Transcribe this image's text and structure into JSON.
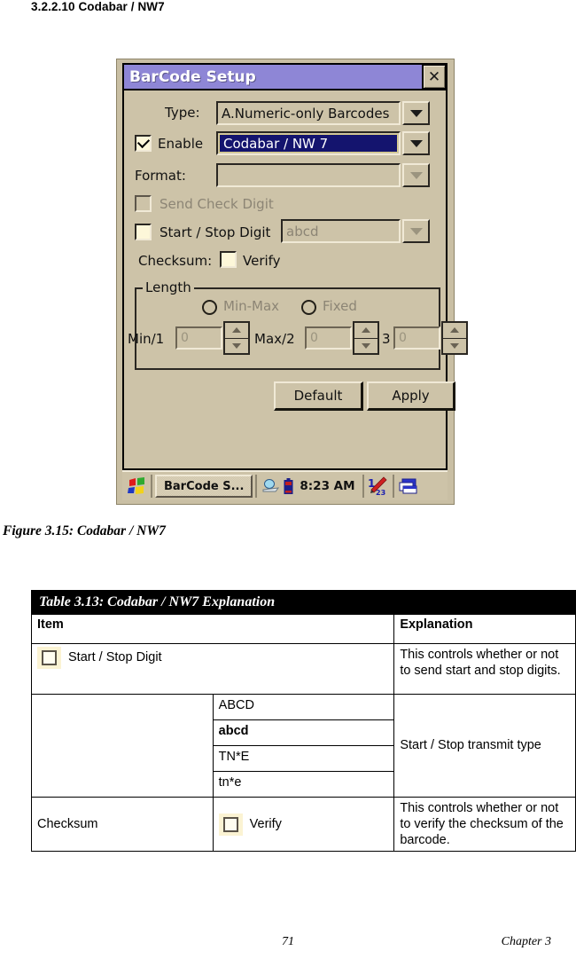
{
  "section": {
    "heading": "3.2.2.10 Codabar / NW7"
  },
  "figure": {
    "caption": "Figure 3.15:  Codabar / NW7"
  },
  "dialog": {
    "title": "BarCode Setup",
    "close_label": "✕",
    "type_label": "Type:",
    "type_value": "A.Numeric-only Barcodes",
    "enable_label": "Enable",
    "enable_checked": "✓",
    "enable_value": "Codabar / NW 7",
    "format_label": "Format:",
    "format_value": "",
    "send_check_digit_label": "Send Check Digit",
    "start_stop_label": "Start / Stop Digit",
    "start_stop_value": "abcd",
    "checksum_label": "Checksum:",
    "verify_label": "Verify",
    "length_group": "Length",
    "min_max_radio": "Min-Max",
    "fixed_radio": "Fixed",
    "min1_label": "Min/1",
    "min1_value": "0",
    "max2_label": "Max/2",
    "max2_value": "0",
    "three_label": "3",
    "three_value": "0",
    "default_button": "Default",
    "apply_button": "Apply",
    "colors": {
      "titlebar": "#8e86d6",
      "face": "#cdc3a8",
      "selection": "#14146e",
      "checkbox_fill": "#fdf7d9"
    }
  },
  "taskbar": {
    "start_icon": "windows-start-icon",
    "task_label": "BarCode S...",
    "tray_icons": [
      "network-icon",
      "battery-icon"
    ],
    "clock": "8:23 AM",
    "input_panel_icon": "sip-keyboard-icon",
    "desktop_icon": "show-desktop-icon"
  },
  "table": {
    "caption": "Table 3.13: Codabar / NW7 Explanation",
    "headers": [
      "Item",
      "Explanation"
    ],
    "rows": [
      {
        "item_checkbox": true,
        "item": "Start / Stop Digit",
        "explanation": "This controls whether or not to send start and stop digits."
      },
      {
        "options": [
          "ABCD",
          "abcd",
          "TN*E",
          "tn*e"
        ],
        "bold_option_index": 1,
        "explanation": "Start / Stop transmit type"
      },
      {
        "item": "Checksum",
        "sub_checkbox": true,
        "sub_item": "Verify",
        "explanation": "This controls whether or not to verify the checksum of the barcode."
      }
    ]
  },
  "footer": {
    "page": "71",
    "chapter": "Chapter 3"
  }
}
